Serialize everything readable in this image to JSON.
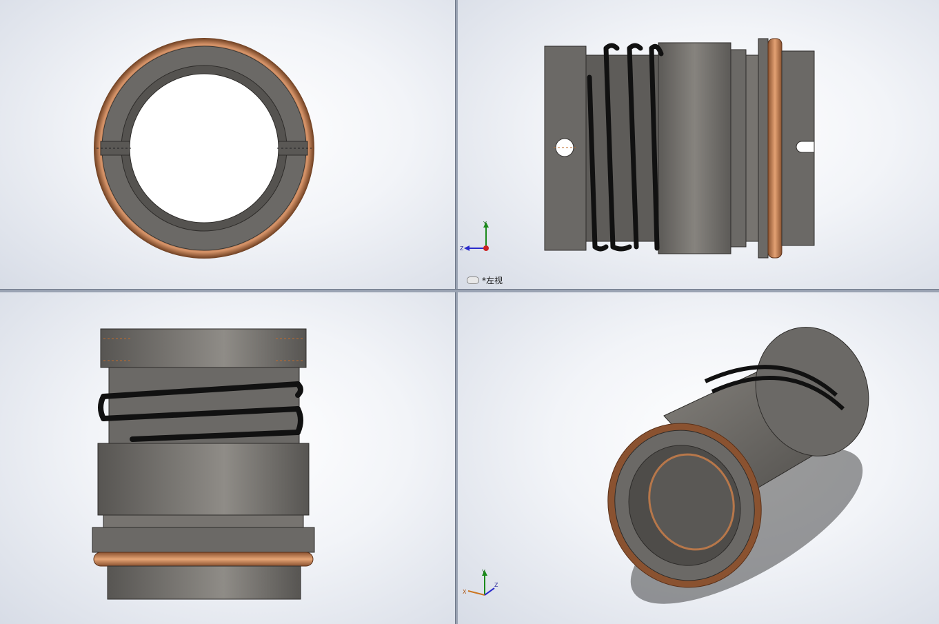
{
  "viewports": {
    "top_left": {
      "name": "front-view"
    },
    "top_right": {
      "name": "left-view",
      "label": "*左视"
    },
    "bottom_left": {
      "name": "top-view"
    },
    "bottom_right": {
      "name": "isometric-view"
    }
  },
  "triad_top_right": {
    "y": "Y",
    "z": "Z"
  },
  "triad_bottom_right": {
    "y": "Y",
    "x": "X",
    "z": "Z"
  },
  "colors": {
    "steel": "#6b6966",
    "steel_light": "#8a8782",
    "copper": "#b7774a",
    "spring": "#111111"
  }
}
